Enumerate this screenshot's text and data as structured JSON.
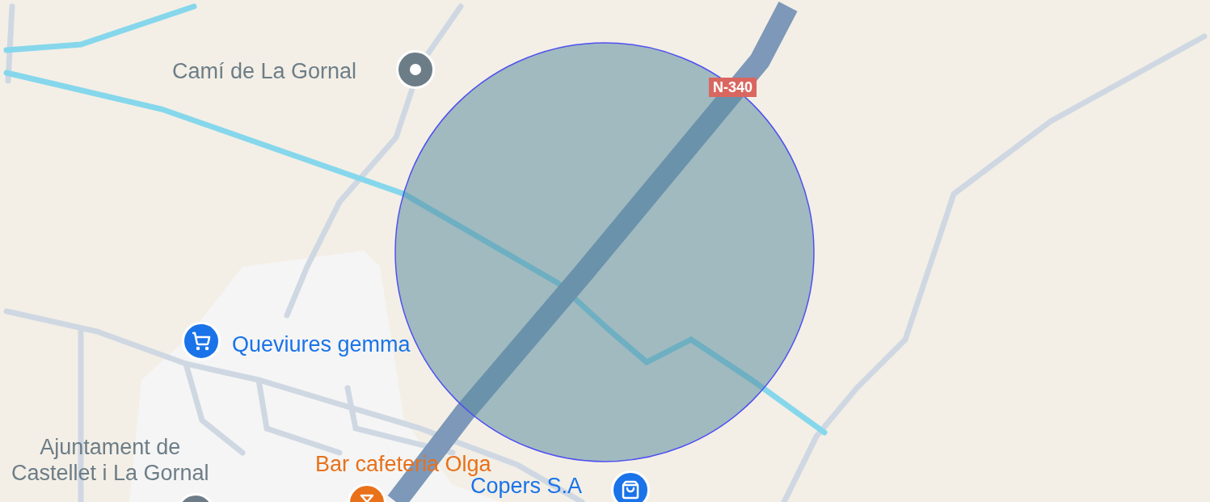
{
  "road_shield": {
    "label": "N-340"
  },
  "places": [
    {
      "kind": "generic",
      "lines": [
        "Camí de La Gornal"
      ],
      "color": "#6d7d87"
    },
    {
      "kind": "grocery",
      "lines": [
        "Queviures gemma"
      ],
      "color": "#1a73e8"
    },
    {
      "kind": "townhall",
      "lines": [
        "Ajuntament de",
        "Castellet i La Gornal"
      ],
      "color": "#6d7d87"
    },
    {
      "kind": "bar",
      "lines": [
        "Bar cafeteria Olga"
      ],
      "color": "#e8711a"
    },
    {
      "kind": "shop",
      "lines": [
        "Copers S.A"
      ],
      "color": "#1a73e8"
    }
  ]
}
